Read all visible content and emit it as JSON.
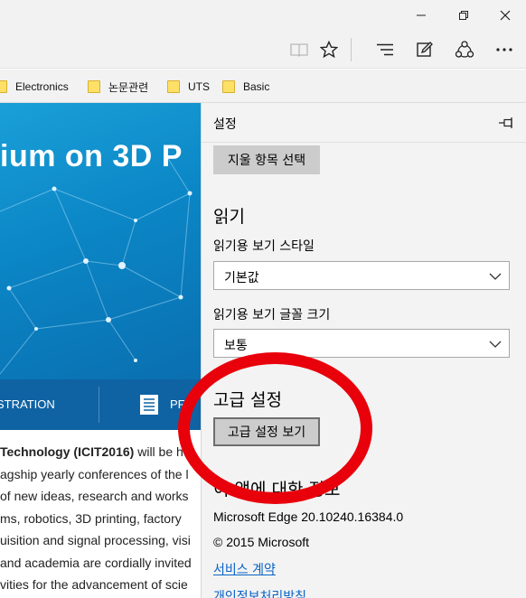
{
  "window": {
    "min_icon": "minimize-icon",
    "max_icon": "restore-icon",
    "close_icon": "close-icon"
  },
  "toolbar": {
    "reading_view_icon": "book-icon",
    "favorite_icon": "star-icon",
    "hub_icon": "hub-icon",
    "note_icon": "web-note-icon",
    "share_icon": "share-icon",
    "more_icon": "more-icon"
  },
  "favorites": [
    {
      "label": "Electronics"
    },
    {
      "label": "논문관련"
    },
    {
      "label": "UTS"
    },
    {
      "label": "Basic"
    }
  ],
  "page": {
    "hero_title": "ium on 3D P",
    "nav_left": "STRATION",
    "nav_right": "PF",
    "lines": [
      {
        "pre": " ",
        "bold": "Technology (ICIT2016)",
        "post": " will be h"
      },
      {
        "pre": "agship yearly conferences of the l",
        "bold": "",
        "post": ""
      },
      {
        "pre": "of new ideas, research and works",
        "bold": "",
        "post": ""
      },
      {
        "pre": "ms, robotics, 3D printing, factory",
        "bold": "",
        "post": ""
      },
      {
        "pre": "uisition and signal processing, visi",
        "bold": "",
        "post": ""
      },
      {
        "pre": "and academia are cordially invited",
        "bold": "",
        "post": ""
      },
      {
        "pre": "vities for the advancement of scie",
        "bold": "",
        "post": ""
      }
    ]
  },
  "settings": {
    "title": "설정",
    "clear_button": "지울 항목 선택",
    "reading_heading": "읽기",
    "reading_style_label": "읽기용 보기 스타일",
    "reading_style_value": "기본값",
    "reading_font_label": "읽기용 보기 글꼴 크기",
    "reading_font_value": "보통",
    "advanced_heading": "고급 설정",
    "advanced_button": "고급 설정 보기",
    "about_heading": "이 앱에 대한 정보",
    "version": "Microsoft Edge 20.10240.16384.0",
    "copyright": "© 2015 Microsoft",
    "terms_link": "서비스 계약",
    "privacy_link": "개인정보처리방침"
  },
  "colors": {
    "annotation": "#e8000b",
    "link": "#0a63c5",
    "hero": "#0b86c6"
  }
}
